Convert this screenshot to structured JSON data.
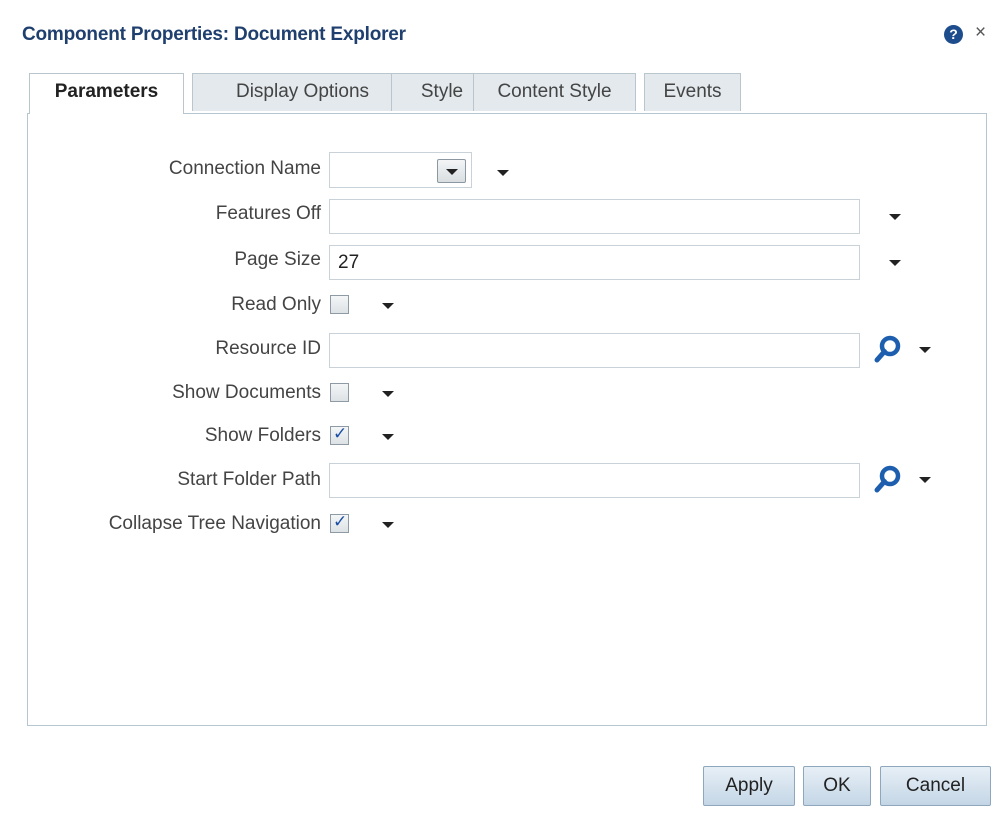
{
  "dialog": {
    "title": "Component Properties: Document Explorer",
    "help_icon_glyph": "?",
    "close_icon_glyph": "×"
  },
  "tabs": [
    {
      "label": "Parameters",
      "active": true
    },
    {
      "label": "Display Options",
      "active": false
    },
    {
      "label": "Style",
      "active": false
    },
    {
      "label": "Content Style",
      "active": false
    },
    {
      "label": "Events",
      "active": false
    }
  ],
  "fields": {
    "connection_name": {
      "label": "Connection Name",
      "value": ""
    },
    "features_off": {
      "label": "Features Off",
      "value": ""
    },
    "page_size": {
      "label": "Page Size",
      "value": "27"
    },
    "read_only": {
      "label": "Read Only",
      "checked": false
    },
    "resource_id": {
      "label": "Resource ID",
      "value": ""
    },
    "show_documents": {
      "label": "Show Documents",
      "checked": false
    },
    "show_folders": {
      "label": "Show Folders",
      "checked": true
    },
    "start_folder_path": {
      "label": "Start Folder Path",
      "value": ""
    },
    "collapse_tree_navigation": {
      "label": "Collapse Tree Navigation",
      "checked": true
    }
  },
  "buttons": {
    "apply": "Apply",
    "ok": "OK",
    "cancel": "Cancel"
  },
  "colors": {
    "title": "#1f3f6e",
    "accent_icon": "#1d5fae",
    "check": "#1b4fa3"
  },
  "icons": {
    "help": "help-icon",
    "close": "close-icon",
    "search": "search-icon",
    "caret": "caret-down-icon"
  }
}
